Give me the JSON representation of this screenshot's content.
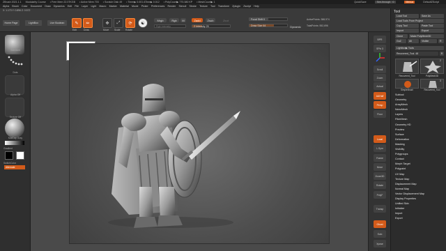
{
  "titlebar": {
    "items": [
      "ZBrush 2021.1.1",
      "Modularity Course",
      "• Free Mem 22.07KGB",
      "• Active Mem 703",
      "• Scratch Disk 49",
      "• Timer▶ 0.001 ATime▶ 0.012",
      "• PolyCount▶ 770.380 KP",
      "• MeshCount▶ 1"
    ],
    "quicksave": "QuickSave",
    "seethrough": "See-through",
    "seethrough_value": "0",
    "menus": "Menus",
    "script": "DefaultZScript"
  },
  "menubar": {
    "items": [
      "Alpha",
      "Brush",
      "Color",
      "Document",
      "Draw",
      "Dynamics",
      "Edit",
      "File",
      "Layer",
      "Light",
      "Macro",
      "Marker",
      "Material",
      "Movie",
      "Picker",
      "Preferences",
      "Render",
      "Stencil",
      "Stroke",
      "Texture",
      "Tool",
      "Transform",
      "Zplugin",
      "Zscript",
      "Help"
    ],
    "coords": "X: 1.173 Y: 0.896 Z: 0.572"
  },
  "file_buttons": {
    "home": "Home Page",
    "lightbox": "LightBox",
    "live_boolean": "Live Boolean"
  },
  "toolbar": {
    "edit": "Edit",
    "draw": "Draw",
    "move": "Move",
    "scale": "Scale",
    "rotate": "Rotate",
    "mrgb": "Mrgb",
    "rgb": "Rgb",
    "m": "M",
    "zadd": "Zadd",
    "zsub": "Zsub",
    "zcut": "Zcut",
    "rgb_intensity": "Rgb Intensity",
    "z_intensity_label": "Z Intensity",
    "z_intensity_value": "25",
    "focal_shift_label": "Focal Shift",
    "focal_shift_value": "0",
    "draw_size_label": "Draw Size",
    "draw_size_value": "64",
    "dynamic": "Dynamic",
    "active_points": "ActivePoints: 388,974",
    "total_points": "TotalPoints: 552,696"
  },
  "leftshelf": {
    "standard": "Standard",
    "dots": "Dots",
    "alpha": "Alpha Off",
    "texture": "Texture Off",
    "material": "MatCap Gray",
    "gradient": "Gradient",
    "switch_color": "SwitchColor",
    "alternate": "Alternate"
  },
  "rightcol": [
    "BPR",
    "SPix 3",
    "Scroll",
    "Zoom",
    "Actual",
    "AAHalf",
    "Persp",
    "Floor",
    "Local",
    "L.Sym",
    "Frame",
    "Move",
    "Zoom3D",
    "Rotate",
    "PolyF",
    "Transp",
    "Ghost",
    "Solo",
    "Xpose"
  ],
  "toolpanel": {
    "title": "Tool",
    "load_tool": "Load Tool",
    "save_as": "Save As",
    "load_from_project": "Load Tools From Project",
    "copy_tool": "Copy Tool",
    "paste_tool": "Paste Tool",
    "import": "Import",
    "export": "Export",
    "clone": "Clone",
    "make_polymesh": "Make PolyMesh3D",
    "goz": "GoZ",
    "all": "All",
    "visible": "Visible",
    "r": "R",
    "lightbox_tools": "Lightbox▶ Tools",
    "recovered_tool_label": "Recovered_Tool.",
    "recovered_tool_value": "48",
    "r_btn": "R",
    "tiles": [
      {
        "caption": "Recovered_Tool"
      },
      {
        "caption": "PolyMesh3D"
      },
      {
        "caption": "SimpleBrush"
      },
      {
        "caption": "Recovered_Tool"
      }
    ],
    "tile_counts": [
      "2",
      "3"
    ],
    "sections": [
      "Subtool",
      "Geometry",
      "ArrayMesh",
      "NanoMesh",
      "Layers",
      "FiberMesh",
      "Geometry HD",
      "Preview",
      "Surface",
      "Deformation",
      "Masking",
      "Visibility",
      "Polygroups",
      "Contact",
      "Morph Target",
      "Polypaint",
      "UV Map",
      "Texture Map",
      "Displacement Map",
      "Normal Map",
      "Vector Displacement Map",
      "Display Properties",
      "Unified Skin",
      "Initialize",
      "Import",
      "Export"
    ]
  },
  "colors": {
    "accent": "#d35b1a",
    "background": "#2b2b2b",
    "canvas": "#5a5a5a"
  }
}
